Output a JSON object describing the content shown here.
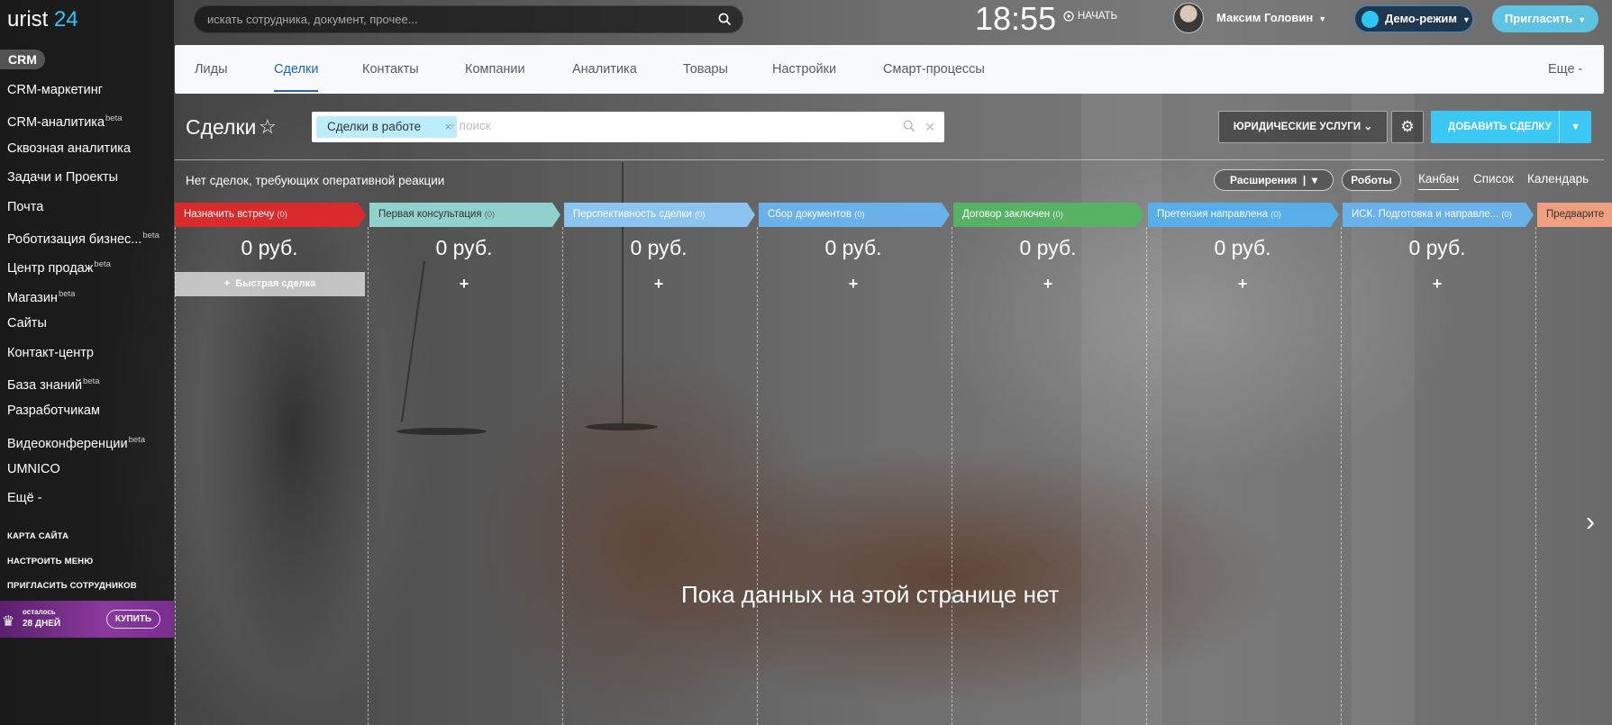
{
  "brand": {
    "name": "urist",
    "num": "24"
  },
  "sidebar": {
    "crm_badge": "CRM",
    "items": [
      {
        "label": "CRM-маркетинг",
        "beta": ""
      },
      {
        "label": "CRM-аналитика",
        "beta": "beta"
      },
      {
        "label": "Сквозная аналитика",
        "beta": ""
      },
      {
        "label": "Задачи и Проекты",
        "beta": ""
      },
      {
        "label": "Почта",
        "beta": ""
      },
      {
        "label": "Роботизация бизнес...",
        "beta": "beta"
      },
      {
        "label": "Центр продаж",
        "beta": "beta"
      },
      {
        "label": "Магазин",
        "beta": "beta"
      },
      {
        "label": "Сайты",
        "beta": ""
      },
      {
        "label": "Контакт-центр",
        "beta": ""
      },
      {
        "label": "База знаний",
        "beta": "beta"
      },
      {
        "label": "Разработчикам",
        "beta": ""
      },
      {
        "label": "Видеоконференции",
        "beta": "beta"
      },
      {
        "label": "UMNICO",
        "beta": ""
      },
      {
        "label": "Ещё -",
        "beta": ""
      }
    ],
    "small_links": [
      "КАРТА САЙТА",
      "НАСТРОИТЬ МЕНЮ",
      "ПРИГЛАСИТЬ СОТРУДНИКОВ"
    ],
    "trial": {
      "line1": "осталось",
      "line2": "28 ДНЕЙ",
      "buy": "КУПИТЬ"
    }
  },
  "header": {
    "search_placeholder": "искать сотрудника, документ, прочее...",
    "time": "18:55",
    "start": "НАЧАТЬ",
    "user": "Максим Головин",
    "demo": "Демо-режим",
    "invite": "Пригласить"
  },
  "tabs": [
    "Лиды",
    "Сделки",
    "Контакты",
    "Компании",
    "Аналитика",
    "Товары",
    "Настройки",
    "Смарт-процессы",
    "Еще -"
  ],
  "page": {
    "title": "Сделки",
    "filter_chip": "Сделки в работе",
    "filter_placeholder": "+ поиск",
    "direction_button": "ЮРИДИЧЕСКИЕ УСЛУГИ",
    "add_button": "ДОБАВИТЬ СДЕЛКУ",
    "notice": "Нет сделок, требующих оперативной реакции",
    "extensions": "Расширения",
    "robots": "Роботы",
    "views": [
      "Канбан",
      "Список",
      "Календарь"
    ],
    "quick_deal": "Быстрая сделка",
    "empty": "Пока данных на этой странице нет"
  },
  "stages": [
    {
      "name": "Назначить встречу",
      "count": "(0)",
      "sum": "0 руб.",
      "color": "#d92b2b"
    },
    {
      "name": "Первая консультация",
      "count": "(0)",
      "sum": "0 руб.",
      "color": "#8fd1cc"
    },
    {
      "name": "Перспективность сделки",
      "count": "(0)",
      "sum": "0 руб.",
      "color": "#8cc4f0"
    },
    {
      "name": "Сбор документов",
      "count": "(0)",
      "sum": "0 руб.",
      "color": "#6ab1ea"
    },
    {
      "name": "Договор заключен",
      "count": "(0)",
      "sum": "0 руб.",
      "color": "#57b266"
    },
    {
      "name": "Претензия направлена",
      "count": "(0)",
      "sum": "0 руб.",
      "color": "#58aee8"
    },
    {
      "name": "ИСК. Подготовка и направле...",
      "count": "(0)",
      "sum": "0 руб.",
      "color": "#6ab1ea"
    },
    {
      "name": "Предварите",
      "count": "",
      "sum": "",
      "color": "#f0a080"
    }
  ]
}
